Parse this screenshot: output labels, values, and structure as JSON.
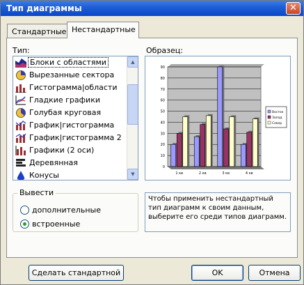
{
  "window": {
    "title": "Тип диаграммы",
    "close_glyph": "✕"
  },
  "tabs": [
    {
      "label": "Стандартные",
      "active": false
    },
    {
      "label": "Нестандартные",
      "active": true
    }
  ],
  "type_section": {
    "label": "Тип:",
    "items": [
      {
        "label": "Блоки с областями",
        "icon": "area-blocks-icon",
        "selected": true
      },
      {
        "label": "Вырезанные сектора",
        "icon": "exploded-pie-icon"
      },
      {
        "label": "Гистограмма|области",
        "icon": "column-area-icon"
      },
      {
        "label": "Гладкие графики",
        "icon": "smooth-line-icon"
      },
      {
        "label": "Голубая круговая",
        "icon": "blue-pie-icon"
      },
      {
        "label": "График|гистограмма",
        "icon": "line-column-icon"
      },
      {
        "label": "График|гистограмма 2",
        "icon": "line-column-2-icon"
      },
      {
        "label": "Графики (2 оси)",
        "icon": "lines-two-axes-icon"
      },
      {
        "label": "Деревянная",
        "icon": "wooden-icon"
      },
      {
        "label": "Конусы",
        "icon": "cones-icon"
      }
    ]
  },
  "output_group": {
    "title": "Вывести",
    "options": [
      {
        "label": "дополнительные",
        "checked": false
      },
      {
        "label": "встроенные",
        "checked": true
      }
    ]
  },
  "sample": {
    "label": "Образец:",
    "chart_data": {
      "type": "bar",
      "categories": [
        "1 кв",
        "2 кв",
        "3 кв",
        "4 кв"
      ],
      "series": [
        {
          "name": "Восток",
          "values": [
            20,
            27,
            90,
            20
          ],
          "color": "#9999ff"
        },
        {
          "name": "Запад",
          "values": [
            30,
            38,
            34,
            31
          ],
          "color": "#993366"
        },
        {
          "name": "Север",
          "values": [
            45,
            46,
            45,
            43
          ],
          "color": "#ffffcc"
        }
      ],
      "ylim": [
        0,
        90
      ],
      "yticks": [
        0,
        10,
        20,
        30,
        40,
        50,
        60,
        70,
        80,
        90
      ],
      "grid": true,
      "legend": "right",
      "plot_background": "#c0c0c0"
    }
  },
  "description": "Чтобы применить нестандартный тип диаграмм к своим данным, выберите его среди типов диаграмм.",
  "buttons": {
    "make_default": "Сделать стандартной",
    "ok": "OK",
    "cancel": "Отмена"
  }
}
